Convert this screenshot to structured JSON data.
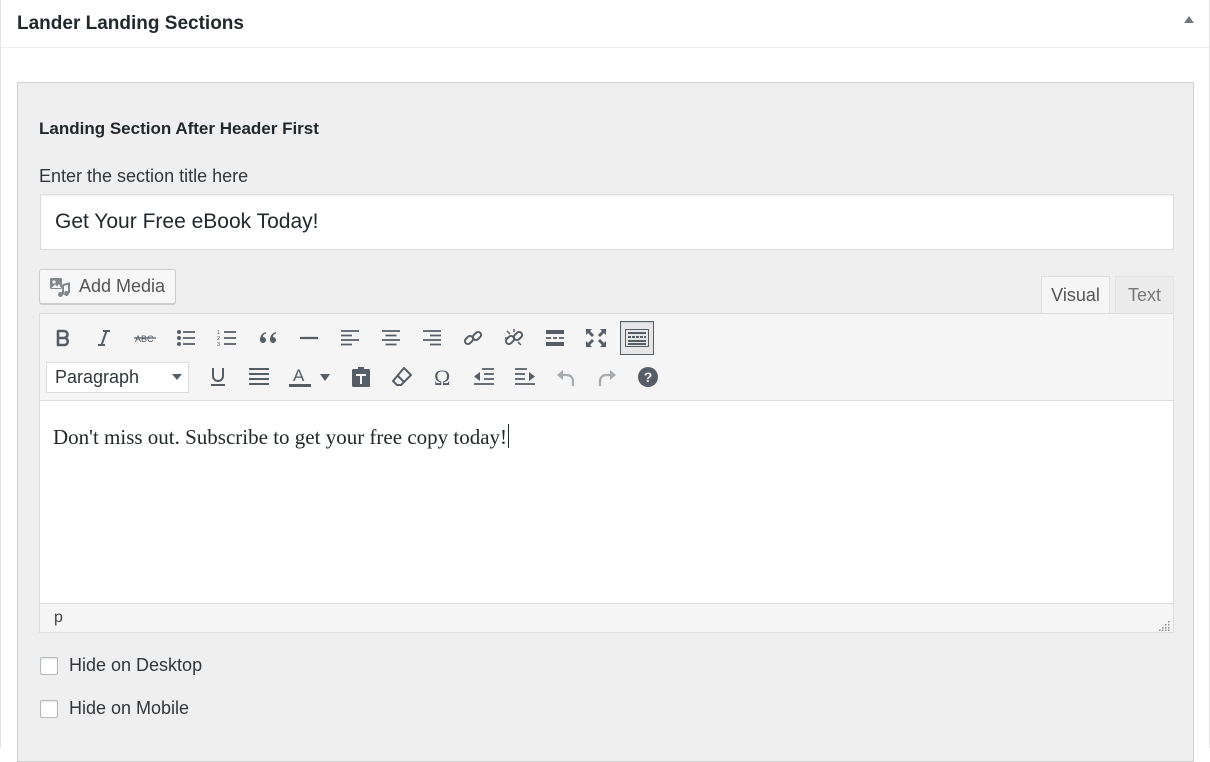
{
  "metabox": {
    "title": "Lander Landing Sections",
    "toggle_icon": "triangle-up-icon"
  },
  "section": {
    "heading": "Landing Section After Header First",
    "title_label": "Enter the section title here",
    "title_value": "Get Your Free eBook Today!"
  },
  "editor": {
    "add_media_label": "Add Media",
    "tabs": {
      "visual": "Visual",
      "text": "Text",
      "active": "visual"
    },
    "toolbar_row1": [
      "bold-icon",
      "italic-icon",
      "strikethrough-icon",
      "bullet-list-icon",
      "numbered-list-icon",
      "blockquote-icon",
      "horizontal-line-icon",
      "align-left-icon",
      "align-center-icon",
      "align-right-icon",
      "link-icon",
      "unlink-icon",
      "read-more-icon",
      "fullscreen-icon",
      "toolbar-toggle-icon"
    ],
    "toolbar_row2": [
      "underline-icon",
      "justify-icon",
      "text-color-icon",
      "paste-as-text-icon",
      "clear-formatting-icon",
      "special-character-icon",
      "outdent-icon",
      "indent-icon",
      "undo-icon",
      "redo-icon",
      "help-icon"
    ],
    "format_select": "Paragraph",
    "content": "Don't miss out. Subscribe to get your free copy today!",
    "path": "p"
  },
  "options": {
    "hide_desktop": "Hide on Desktop",
    "hide_mobile": "Hide on Mobile"
  },
  "colors": {
    "icon": "#555d66",
    "section_bg": "#efefef",
    "border": "#dddddd"
  }
}
